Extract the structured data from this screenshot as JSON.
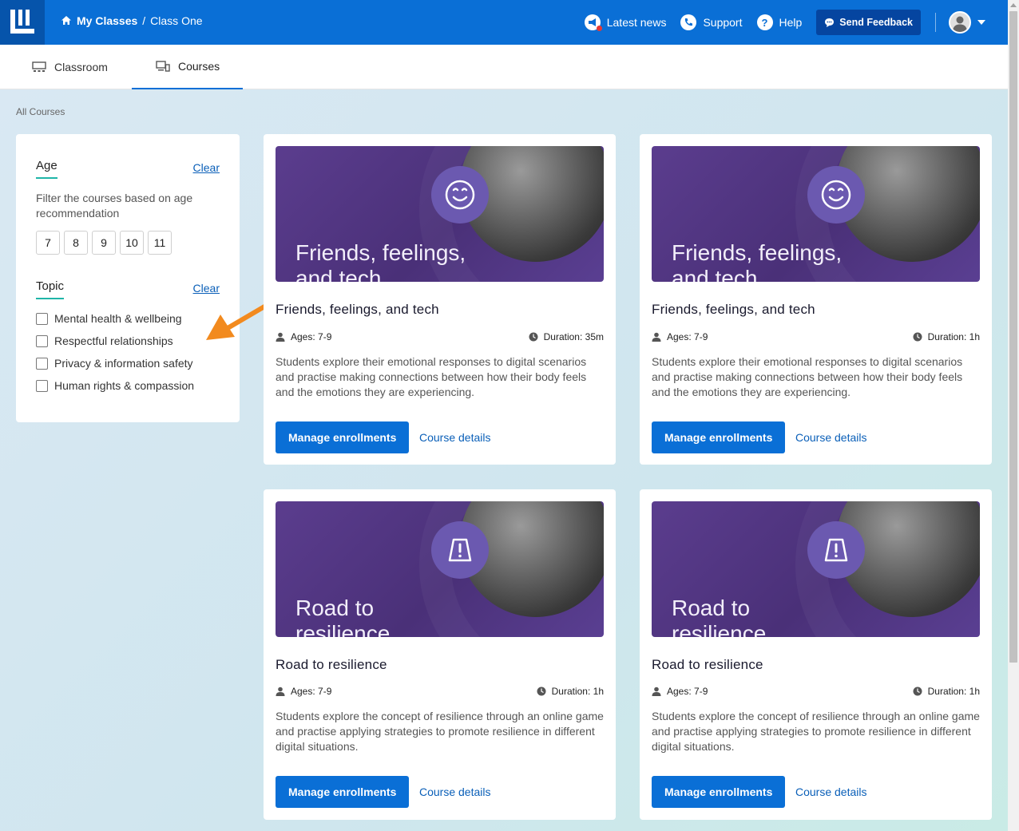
{
  "header": {
    "breadcrumb": {
      "home_label": "My Classes",
      "separator": "/",
      "current": "Class One"
    },
    "links": [
      {
        "label": "Latest news",
        "icon": "megaphone-icon"
      },
      {
        "label": "Support",
        "icon": "phone-icon"
      },
      {
        "label": "Help",
        "icon": "question-icon"
      }
    ],
    "feedback_label": "Send Feedback"
  },
  "tabs": [
    {
      "label": "Classroom",
      "icon": "classroom-icon",
      "active": false
    },
    {
      "label": "Courses",
      "icon": "devices-icon",
      "active": true
    }
  ],
  "page": {
    "section_label": "All Courses"
  },
  "filters": {
    "age": {
      "heading": "Age",
      "clear_label": "Clear",
      "description": "Filter the courses based on age recommendation",
      "options": [
        "7",
        "8",
        "9",
        "10",
        "11"
      ]
    },
    "topic": {
      "heading": "Topic",
      "clear_label": "Clear",
      "options": [
        "Mental health & wellbeing",
        "Respectful relationships",
        "Privacy & information safety",
        "Human rights & compassion"
      ]
    }
  },
  "courses": [
    {
      "title": "Friends, feelings, and tech",
      "banner_line1": "Friends, feelings,",
      "banner_line2": "and tech",
      "banner_icon": "smiley-icon",
      "ages": "Ages: 7-9",
      "duration": "Duration: 35m",
      "description": "Students explore their emotional responses to digital scenarios and practise making connections between how their body feels and the emotions they are experiencing.",
      "primary_label": "Manage enrollments",
      "secondary_label": "Course details"
    },
    {
      "title": "Friends, feelings, and tech",
      "banner_line1": "Friends, feelings,",
      "banner_line2": "and tech",
      "banner_icon": "smiley-icon",
      "ages": "Ages: 7-9",
      "duration": "Duration: 1h",
      "description": "Students explore their emotional responses to digital scenarios and practise making connections between how their body feels and the emotions they are experiencing.",
      "primary_label": "Manage enrollments",
      "secondary_label": "Course details"
    },
    {
      "title": "Road to resilience",
      "banner_line1": "Road to",
      "banner_line2": "resilience",
      "banner_icon": "warning-sign-icon",
      "ages": "Ages: 7-9",
      "duration": "Duration: 1h",
      "description": "Students explore the concept of resilience through an online game and practise applying strategies to promote resilience in different digital situations.",
      "primary_label": "Manage enrollments",
      "secondary_label": "Course details"
    },
    {
      "title": "Road to resilience",
      "banner_line1": "Road to",
      "banner_line2": "resilience",
      "banner_icon": "warning-sign-icon",
      "ages": "Ages: 7-9",
      "duration": "Duration: 1h",
      "description": "Students explore the concept of resilience through an online game and practise applying strategies to promote resilience in different digital situations.",
      "primary_label": "Manage enrollments",
      "secondary_label": "Course details"
    }
  ],
  "colors": {
    "header": "#0a6fd6",
    "accent": "#1fb5a8",
    "banner": "#4a3078",
    "annotation_arrow": "#f28a1e"
  }
}
